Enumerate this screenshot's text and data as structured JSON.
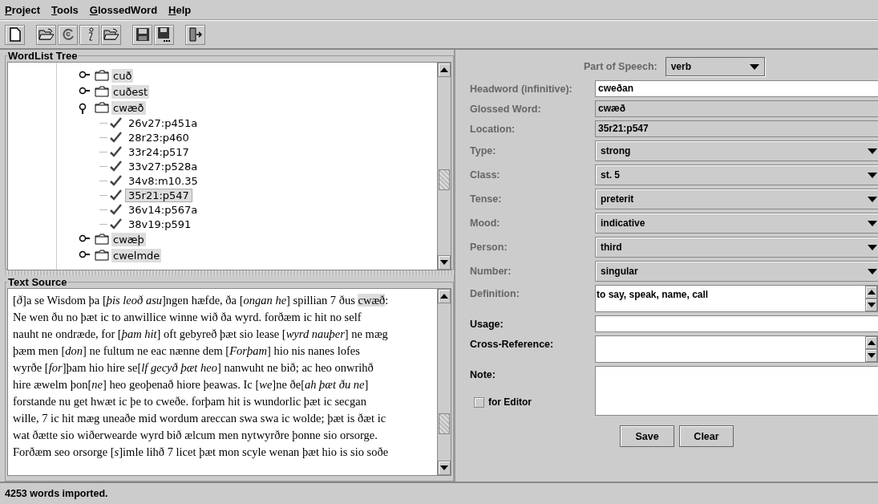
{
  "menu": [
    {
      "label": "Project"
    },
    {
      "label": "Tools"
    },
    {
      "label": "GlossedWord"
    },
    {
      "label": "Help"
    }
  ],
  "toolbar": [
    {
      "kind": "new"
    },
    {
      "kind": "open"
    },
    {
      "kind": "refresh"
    },
    {
      "kind": "info"
    },
    {
      "kind": "open"
    },
    {
      "kind": "save"
    },
    {
      "kind": "saveas"
    },
    {
      "kind": "exit"
    }
  ],
  "tree": {
    "title": "WordList Tree",
    "nodes": [
      {
        "label": "cuð",
        "expanded": false
      },
      {
        "label": "cuðest",
        "expanded": false
      },
      {
        "label": "cwæð",
        "expanded": true,
        "children": [
          {
            "label": "26v27:p451a",
            "selected": false
          },
          {
            "label": "28r23:p460",
            "selected": false
          },
          {
            "label": "33r24:p517",
            "selected": false
          },
          {
            "label": "33v27:p528a",
            "selected": false
          },
          {
            "label": "34v8:m10.35",
            "selected": false
          },
          {
            "label": "35r21:p547",
            "selected": true
          },
          {
            "label": "36v14:p567a",
            "selected": false
          },
          {
            "label": "38v19:p591",
            "selected": false
          }
        ]
      },
      {
        "label": "cwæþ",
        "expanded": false
      },
      {
        "label": "cwelmde",
        "expanded": false
      }
    ]
  },
  "text_source": {
    "title": "Text Source",
    "lines": [
      [
        {
          "text": "[*ð*]a se Wisdom þa [*þis leoð asu*]ngen hæfde, ða [*ongan he*] spillian 7 ðus ",
          "highlighted": false
        },
        {
          "text": "cwæð",
          "highlighted": true
        },
        {
          "text": ":",
          "highlighted": false
        }
      ],
      [
        {
          "text": "Ne wen ðu no þæt ic to anwillice winne wið ða wyrd.  forðæm ic hit no self",
          "highlighted": false
        }
      ],
      [
        {
          "text": "nauht ne ondræde, for [*þam hit*] oft gebyreð þæt sio lease [*wyrd nauþer*] ne mæg",
          "highlighted": false
        }
      ],
      [
        {
          "text": "þæm men [*don*] ne fultum ne eac nænne dem  [*Forþam*] hio nis nanes lofes",
          "highlighted": false
        }
      ],
      [
        {
          "text": "wyrðe  [*for*]þam hio hire se[*lf gecyð þæt heo*] nanwuht ne bið; ac heo onwrihð",
          "highlighted": false
        }
      ],
      [
        {
          "text": "hire æwelm þon[*ne*] heo geoþenað hiore þeawas.  Ic [*we*]ne ðe[*ah þæt ðu ne*]",
          "highlighted": false
        }
      ],
      [
        {
          "text": "forstande nu get hwæt ic þe to cweðe.  forþam hit is wundorlic þæt ic secgan",
          "highlighted": false
        }
      ],
      [
        {
          "text": "wille, 7 ic hit mæg uneaðe mid wordum areccan swa swa ic wolde; þæt is ðæt ic",
          "highlighted": false
        }
      ],
      [
        {
          "text": "wat ðætte sio wiðerwearde wyrd bið ælcum men nytwyrðre þonne sio orsorge.",
          "highlighted": false
        }
      ],
      [
        {
          "text": "Forðæm seo orsorge [*s*]imle lihð 7 licet þæt mon scyle wenan þæt hio is sio soðe",
          "highlighted": false
        }
      ]
    ]
  },
  "part_of_speech": {
    "label": "Part of Speech:",
    "value": "verb"
  },
  "fields": [
    {
      "label": "Headword (infinitive):",
      "kind": "text",
      "greyed": true,
      "value": "cweðan"
    },
    {
      "label": "Glossed Word:",
      "kind": "readonly",
      "greyed": true,
      "value": "cwæð"
    },
    {
      "label": "Location:",
      "kind": "readonly",
      "greyed": true,
      "value": "35r21:p547"
    },
    {
      "label": "Type:",
      "kind": "combo",
      "greyed": true,
      "value": "strong"
    },
    {
      "label": "Class:",
      "kind": "combo",
      "greyed": true,
      "value": "st. 5"
    },
    {
      "label": "Tense:",
      "kind": "combo",
      "greyed": true,
      "value": "preterit"
    },
    {
      "label": "Mood:",
      "kind": "combo",
      "greyed": true,
      "value": "indicative"
    },
    {
      "label": "Person:",
      "kind": "combo",
      "greyed": true,
      "value": "third"
    },
    {
      "label": "Number:",
      "kind": "combo",
      "greyed": true,
      "value": "singular"
    },
    {
      "label": "Definition:",
      "kind": "area",
      "greyed": true,
      "value": "to say, speak, name, call"
    },
    {
      "label": "Usage:",
      "kind": "text",
      "greyed": false
    },
    {
      "label": "Cross-Reference:",
      "kind": "area",
      "greyed": false
    },
    {
      "label": "Note:",
      "kind": "note",
      "greyed": false,
      "checkbox": {
        "label": "for Editor",
        "checked": false
      }
    }
  ],
  "buttons": [
    {
      "label": "Save"
    },
    {
      "label": "Clear"
    }
  ],
  "status_bar": "4253 words imported."
}
